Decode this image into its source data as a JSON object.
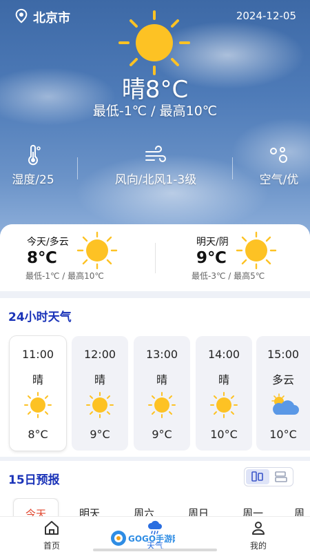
{
  "header": {
    "city": "北京市",
    "date": "2024-12-05",
    "location_icon": "map-pin-icon"
  },
  "current": {
    "temp_text": "晴8°C",
    "range_text": "最低-1℃ / 最高10℃",
    "icon": "sun-icon"
  },
  "stats": [
    {
      "icon": "thermometer-icon",
      "label": "湿度/25"
    },
    {
      "icon": "wind-icon",
      "label": "风向/北风1-3级"
    },
    {
      "icon": "air-quality-icon",
      "label": "空气/优"
    }
  ],
  "summary": {
    "today": {
      "title": "今天/多云",
      "temp": "8℃",
      "range": "最低-1℃ / 最高10℃",
      "icon": "sun-icon"
    },
    "tomorrow": {
      "title": "明天/阴",
      "temp": "9℃",
      "range": "最低-3℃ / 最高5℃",
      "icon": "sun-icon"
    }
  },
  "hourly": {
    "title": "24小时天气",
    "items": [
      {
        "time": "11:00",
        "cond": "晴",
        "temp": "8°C",
        "icon": "sun-icon"
      },
      {
        "time": "12:00",
        "cond": "晴",
        "temp": "9°C",
        "icon": "sun-icon"
      },
      {
        "time": "13:00",
        "cond": "晴",
        "temp": "9°C",
        "icon": "sun-icon"
      },
      {
        "time": "14:00",
        "cond": "晴",
        "temp": "10°C",
        "icon": "sun-icon"
      },
      {
        "time": "15:00",
        "cond": "多云",
        "temp": "10°C",
        "icon": "partly-cloudy-icon"
      }
    ]
  },
  "forecast": {
    "title": "15日预报",
    "view_icons": [
      "chart-view-icon",
      "list-view-icon"
    ],
    "tabs": [
      "今天",
      "明天",
      "周六",
      "周日",
      "周一",
      "周"
    ]
  },
  "nav": {
    "items": [
      {
        "label": "首页",
        "icon": "home-icon"
      },
      {
        "label": "天气",
        "icon": "cloud-rain-icon"
      },
      {
        "label": "我的",
        "icon": "user-icon"
      }
    ]
  },
  "watermark": {
    "text": "GOGO手游网"
  },
  "colors": {
    "sun": "#FDC224",
    "accent_blue": "#1A33B8",
    "active_tab": "#E0472F"
  }
}
